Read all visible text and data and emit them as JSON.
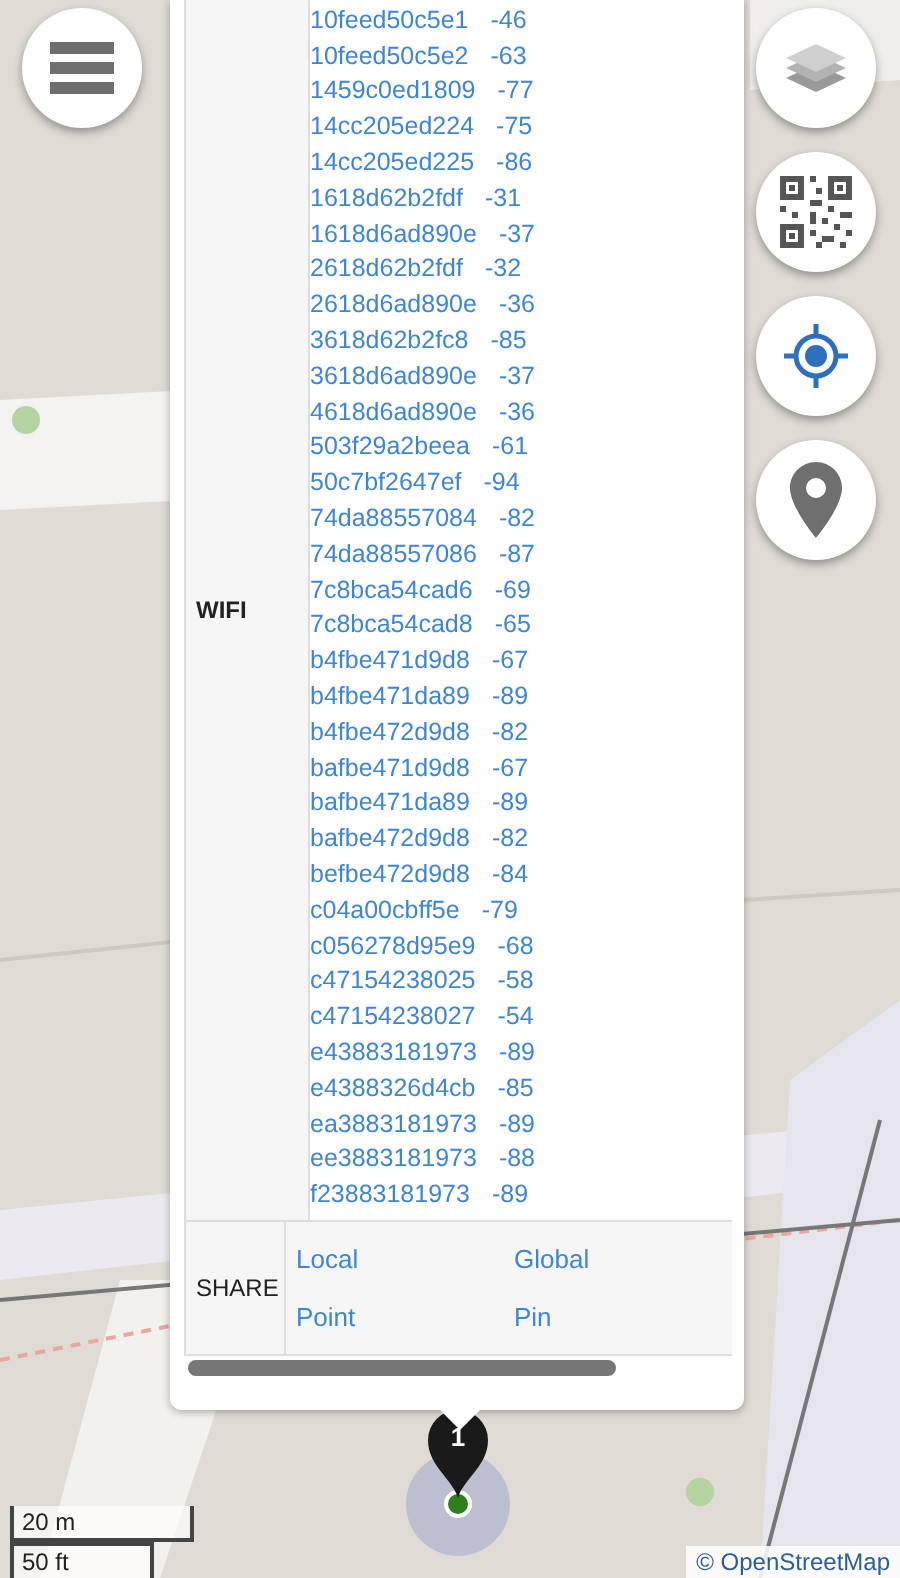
{
  "popup": {
    "wifi_label": "WIFI",
    "wifi": [
      {
        "bssid": "10feed50c5e1",
        "rssi": "-46"
      },
      {
        "bssid": "10feed50c5e2",
        "rssi": "-63"
      },
      {
        "bssid": "1459c0ed1809",
        "rssi": "-77"
      },
      {
        "bssid": "14cc205ed224",
        "rssi": "-75"
      },
      {
        "bssid": "14cc205ed225",
        "rssi": "-86"
      },
      {
        "bssid": "1618d62b2fdf",
        "rssi": "-31"
      },
      {
        "bssid": "1618d6ad890e",
        "rssi": "-37"
      },
      {
        "bssid": "2618d62b2fdf",
        "rssi": "-32"
      },
      {
        "bssid": "2618d6ad890e",
        "rssi": "-36"
      },
      {
        "bssid": "3618d62b2fc8",
        "rssi": "-85"
      },
      {
        "bssid": "3618d6ad890e",
        "rssi": "-37"
      },
      {
        "bssid": "4618d6ad890e",
        "rssi": "-36"
      },
      {
        "bssid": "503f29a2beea",
        "rssi": "-61"
      },
      {
        "bssid": "50c7bf2647ef",
        "rssi": "-94"
      },
      {
        "bssid": "74da88557084",
        "rssi": "-82"
      },
      {
        "bssid": "74da88557086",
        "rssi": "-87"
      },
      {
        "bssid": "7c8bca54cad6",
        "rssi": "-69"
      },
      {
        "bssid": "7c8bca54cad8",
        "rssi": "-65"
      },
      {
        "bssid": "b4fbe471d9d8",
        "rssi": "-67"
      },
      {
        "bssid": "b4fbe471da89",
        "rssi": "-89"
      },
      {
        "bssid": "b4fbe472d9d8",
        "rssi": "-82"
      },
      {
        "bssid": "bafbe471d9d8",
        "rssi": "-67"
      },
      {
        "bssid": "bafbe471da89",
        "rssi": "-89"
      },
      {
        "bssid": "bafbe472d9d8",
        "rssi": "-82"
      },
      {
        "bssid": "befbe472d9d8",
        "rssi": "-84"
      },
      {
        "bssid": "c04a00cbff5e",
        "rssi": "-79"
      },
      {
        "bssid": "c056278d95e9",
        "rssi": "-68"
      },
      {
        "bssid": "c47154238025",
        "rssi": "-58"
      },
      {
        "bssid": "c47154238027",
        "rssi": "-54"
      },
      {
        "bssid": "e43883181973",
        "rssi": "-89"
      },
      {
        "bssid": "e4388326d4cb",
        "rssi": "-85"
      },
      {
        "bssid": "ea3883181973",
        "rssi": "-89"
      },
      {
        "bssid": "ee3883181973",
        "rssi": "-88"
      },
      {
        "bssid": "f23883181973",
        "rssi": "-89"
      }
    ],
    "share_label": "SHARE",
    "share_links": [
      "Local Point",
      "Global Pin"
    ]
  },
  "marker": {
    "label": "1"
  },
  "scale": [
    "20 m",
    "50 ft"
  ],
  "attribution": "© OpenStreetMap"
}
